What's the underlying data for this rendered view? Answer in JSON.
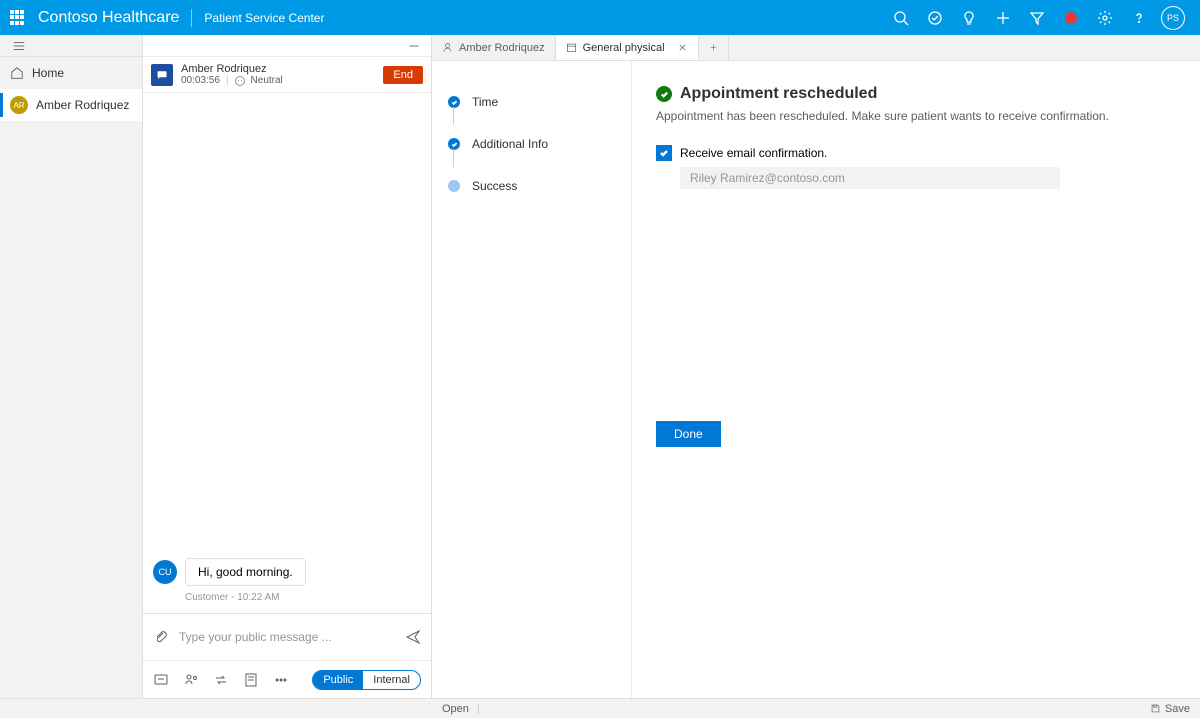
{
  "header": {
    "brand": "Contoso Healthcare",
    "subtitle": "Patient Service Center",
    "avatar_initials": "PS"
  },
  "leftnav": {
    "home": "Home",
    "active_item": "Amber Rodriquez",
    "active_initials": "AR"
  },
  "conversation": {
    "name": "Amber Rodriquez",
    "timer": "00:03:56",
    "sentiment": "Neutral",
    "end_label": "End",
    "message_avatar": "CU",
    "message_text": "Hi, good morning.",
    "message_meta": "Customer - 10:22 AM",
    "compose_placeholder": "Type your public message ...",
    "toggle_public": "Public",
    "toggle_internal": "Internal"
  },
  "tabs": [
    {
      "label": "Amber Rodriquez"
    },
    {
      "label": "General physical"
    }
  ],
  "steps": [
    {
      "label": "Time",
      "done": true
    },
    {
      "label": "Additional Info",
      "done": true
    },
    {
      "label": "Success",
      "done": false
    }
  ],
  "detail": {
    "title": "Appointment rescheduled",
    "subtitle": "Appointment has been rescheduled. Make sure patient wants to receive confirmation.",
    "checkbox_label": "Receive email confirmation.",
    "email_value": "Riley Ramirez@contoso.com",
    "done_label": "Done"
  },
  "statusbar": {
    "open": "Open",
    "save": "Save"
  }
}
